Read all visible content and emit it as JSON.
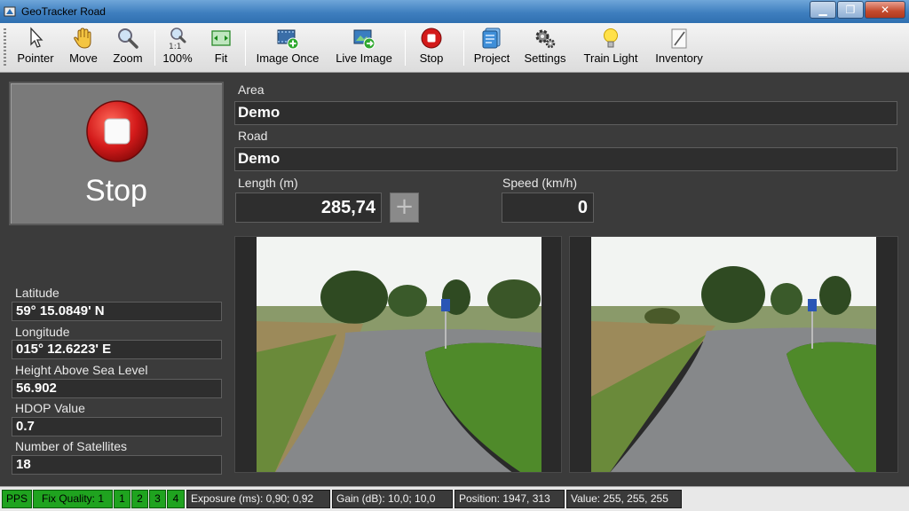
{
  "window": {
    "title": "GeoTracker Road",
    "buttons": {
      "minimize": "▁",
      "maximize": "❐",
      "close": "✕"
    }
  },
  "toolbar": {
    "items": [
      {
        "label": "Pointer",
        "icon": "pointer-icon"
      },
      {
        "label": "Move",
        "icon": "hand-icon"
      },
      {
        "label": "Zoom",
        "icon": "magnifier-icon"
      },
      {
        "label": "100%",
        "icon": "zoom-100-icon",
        "icon_text": "1:1"
      },
      {
        "label": "Fit",
        "icon": "fit-icon"
      },
      {
        "label": "Image Once",
        "icon": "film-add-icon"
      },
      {
        "label": "Live Image",
        "icon": "live-image-icon"
      },
      {
        "label": "Stop",
        "icon": "stop-icon"
      },
      {
        "label": "Project",
        "icon": "project-icon"
      },
      {
        "label": "Settings",
        "icon": "gears-icon"
      },
      {
        "label": "Train Light",
        "icon": "lightbulb-icon"
      },
      {
        "label": "Inventory",
        "icon": "pencil-icon"
      }
    ]
  },
  "stop_button": {
    "label": "Stop"
  },
  "area": {
    "label": "Area",
    "value": "Demo"
  },
  "road": {
    "label": "Road",
    "value": "Demo"
  },
  "length": {
    "label": "Length (m)",
    "value": "285,74",
    "plus": "+"
  },
  "speed": {
    "label": "Speed (km/h)",
    "value": "0"
  },
  "gps": {
    "latitude": {
      "label": "Latitude",
      "value": "59° 15.0849' N"
    },
    "longitude": {
      "label": "Longitude",
      "value": "015° 12.6223' E"
    },
    "height": {
      "label": "Height Above Sea Level",
      "value": "56.902"
    },
    "hdop": {
      "label": "HDOP Value",
      "value": "0.7"
    },
    "satellites": {
      "label": "Number of Satellites",
      "value": "18"
    }
  },
  "status": {
    "pps": "PPS",
    "fix_quality": "Fix Quality: 1",
    "sats": [
      "1",
      "2",
      "3",
      "4"
    ],
    "exposure": "Exposure (ms): 0,90; 0,92",
    "gain": "Gain (dB): 10,0; 10,0",
    "position": "Position: 1947, 313",
    "value": "Value: 255, 255, 255"
  },
  "colors": {
    "background": "#3b3b3b",
    "status_green": "#1fa31f",
    "stop_red": "#d31a1a"
  }
}
